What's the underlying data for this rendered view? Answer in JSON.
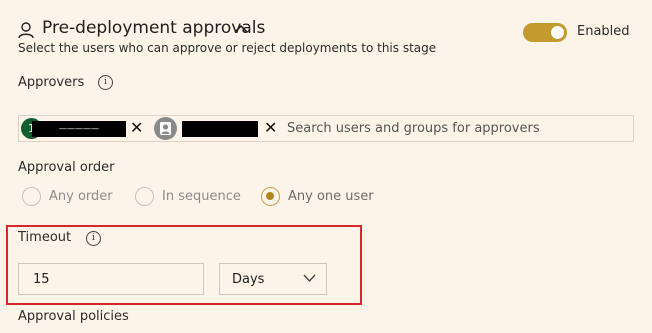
{
  "header": {
    "title": "Pre-deployment approvals",
    "description": "Select the users who can approve or reject deployments to this stage",
    "user_icon": "person-icon",
    "collapse_icon": "chevron-up-icon"
  },
  "toggle": {
    "label": "Enabled",
    "on": true,
    "color": "#c49a2e"
  },
  "approvers": {
    "label": "Approvers",
    "info_icon": "info-icon",
    "chips": [
      {
        "avatar_text": "1",
        "name": "—————",
        "avatar_color": "#0f5e2c",
        "remove_icon": "close-icon"
      },
      {
        "avatar_icon": "user-avatar-icon",
        "name": "",
        "remove_icon": "close-icon"
      }
    ],
    "search_placeholder": "Search users and groups for approvers"
  },
  "approval_order": {
    "label": "Approval order",
    "options": [
      {
        "label": "Any order",
        "selected": false
      },
      {
        "label": "In sequence",
        "selected": false
      },
      {
        "label": "Any one user",
        "selected": true
      }
    ]
  },
  "timeout": {
    "label": "Timeout",
    "info_icon": "info-icon",
    "value": "15",
    "unit": "Days",
    "unit_icon": "chevron-down-icon",
    "highlight_color": "#d6262b"
  },
  "approval_policies": {
    "label": "Approval policies"
  }
}
